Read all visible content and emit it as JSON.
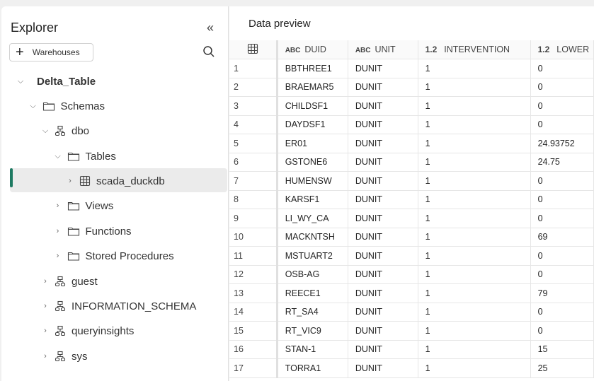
{
  "explorer": {
    "title": "Explorer",
    "add_button": "Warehouses",
    "tree": [
      {
        "label": "Delta_Table",
        "icon": "none",
        "expanded": true,
        "level": 0
      },
      {
        "label": "Schemas",
        "icon": "folder-icon",
        "expanded": true,
        "level": 1
      },
      {
        "label": "dbo",
        "icon": "schema-icon",
        "expanded": true,
        "level": 2
      },
      {
        "label": "Tables",
        "icon": "folder-icon",
        "expanded": true,
        "level": 3
      },
      {
        "label": "scada_duckdb",
        "icon": "table-icon",
        "expanded": false,
        "level": 4,
        "selected": true
      },
      {
        "label": "Views",
        "icon": "folder-icon",
        "expanded": false,
        "level": 3
      },
      {
        "label": "Functions",
        "icon": "folder-icon",
        "expanded": false,
        "level": 3
      },
      {
        "label": "Stored Procedures",
        "icon": "folder-icon",
        "expanded": false,
        "level": 3
      },
      {
        "label": "guest",
        "icon": "schema-icon",
        "expanded": false,
        "level": 2
      },
      {
        "label": "INFORMATION_SCHEMA",
        "icon": "schema-icon",
        "expanded": false,
        "level": 2
      },
      {
        "label": "queryinsights",
        "icon": "schema-icon",
        "expanded": false,
        "level": 2
      },
      {
        "label": "sys",
        "icon": "schema-icon",
        "expanded": false,
        "level": 2
      }
    ]
  },
  "preview": {
    "title": "Data preview",
    "columns": [
      {
        "type": "ABC",
        "name": "DUID"
      },
      {
        "type": "ABC",
        "name": "UNIT"
      },
      {
        "type": "1.2",
        "name": "INTERVENTION"
      },
      {
        "type": "1.2",
        "name": "LOWER"
      }
    ],
    "rows": [
      [
        "1",
        "BBTHREE1",
        "DUNIT",
        "1",
        "0"
      ],
      [
        "2",
        "BRAEMAR5",
        "DUNIT",
        "1",
        "0"
      ],
      [
        "3",
        "CHILDSF1",
        "DUNIT",
        "1",
        "0"
      ],
      [
        "4",
        "DAYDSF1",
        "DUNIT",
        "1",
        "0"
      ],
      [
        "5",
        "ER01",
        "DUNIT",
        "1",
        "24.93752"
      ],
      [
        "6",
        "GSTONE6",
        "DUNIT",
        "1",
        "24.75"
      ],
      [
        "7",
        "HUMENSW",
        "DUNIT",
        "1",
        "0"
      ],
      [
        "8",
        "KARSF1",
        "DUNIT",
        "1",
        "0"
      ],
      [
        "9",
        "LI_WY_CA",
        "DUNIT",
        "1",
        "0"
      ],
      [
        "10",
        "MACKNTSH",
        "DUNIT",
        "1",
        "69"
      ],
      [
        "11",
        "MSTUART2",
        "DUNIT",
        "1",
        "0"
      ],
      [
        "12",
        "OSB-AG",
        "DUNIT",
        "1",
        "0"
      ],
      [
        "13",
        "REECE1",
        "DUNIT",
        "1",
        "79"
      ],
      [
        "14",
        "RT_SA4",
        "DUNIT",
        "1",
        "0"
      ],
      [
        "15",
        "RT_VIC9",
        "DUNIT",
        "1",
        "0"
      ],
      [
        "16",
        "STAN-1",
        "DUNIT",
        "1",
        "15"
      ],
      [
        "17",
        "TORRA1",
        "DUNIT",
        "1",
        "25"
      ]
    ]
  },
  "colors": {
    "accent": "#1e7a62"
  }
}
